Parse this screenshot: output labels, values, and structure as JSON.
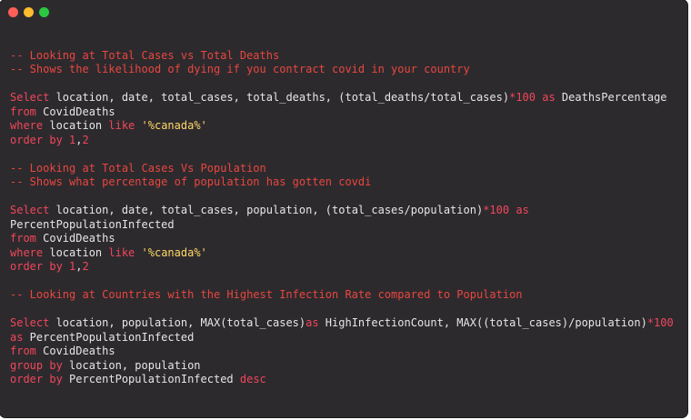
{
  "window": {
    "controls": {
      "close_color": "#ff5f57",
      "minimize_color": "#febc2e",
      "maximize_color": "#28c840"
    }
  },
  "editor": {
    "lines": [
      [],
      [
        {
          "t": "-- Looking at Total Cases vs Total Deaths",
          "c": "comment"
        }
      ],
      [
        {
          "t": "-- Shows the likelihood of dying if you contract covid in your country",
          "c": "comment"
        }
      ],
      [],
      [
        {
          "t": "Select",
          "c": "kw"
        },
        {
          "t": " location, date, total_cases, total_deaths, (total_deaths/total_cases)",
          "c": "plain"
        },
        {
          "t": "*",
          "c": "kw"
        },
        {
          "t": "100",
          "c": "num"
        },
        {
          "t": " ",
          "c": "plain"
        },
        {
          "t": "as",
          "c": "kw"
        },
        {
          "t": " DeathsPercentage",
          "c": "plain"
        }
      ],
      [
        {
          "t": "from",
          "c": "kw"
        },
        {
          "t": " CovidDeaths",
          "c": "plain"
        }
      ],
      [
        {
          "t": "where",
          "c": "kw"
        },
        {
          "t": " location ",
          "c": "plain"
        },
        {
          "t": "like",
          "c": "kw"
        },
        {
          "t": " ",
          "c": "plain"
        },
        {
          "t": "'%canada%'",
          "c": "str"
        }
      ],
      [
        {
          "t": "order by",
          "c": "kw"
        },
        {
          "t": " ",
          "c": "plain"
        },
        {
          "t": "1",
          "c": "num"
        },
        {
          "t": ",",
          "c": "plain"
        },
        {
          "t": "2",
          "c": "num"
        }
      ],
      [],
      [
        {
          "t": "-- Looking at Total Cases Vs Population",
          "c": "comment"
        }
      ],
      [
        {
          "t": "-- Shows what percentage of population has gotten covdi",
          "c": "comment"
        }
      ],
      [],
      [
        {
          "t": "Select",
          "c": "kw"
        },
        {
          "t": " location, date, total_cases, population, (total_cases/population)",
          "c": "plain"
        },
        {
          "t": "*",
          "c": "kw"
        },
        {
          "t": "100",
          "c": "num"
        },
        {
          "t": " ",
          "c": "plain"
        },
        {
          "t": "as",
          "c": "kw"
        }
      ],
      [
        {
          "t": "PercentPopulationInfected",
          "c": "plain"
        }
      ],
      [
        {
          "t": "from",
          "c": "kw"
        },
        {
          "t": " CovidDeaths",
          "c": "plain"
        }
      ],
      [
        {
          "t": "where",
          "c": "kw"
        },
        {
          "t": " location ",
          "c": "plain"
        },
        {
          "t": "like",
          "c": "kw"
        },
        {
          "t": " ",
          "c": "plain"
        },
        {
          "t": "'%canada%'",
          "c": "str"
        }
      ],
      [
        {
          "t": "order by",
          "c": "kw"
        },
        {
          "t": " ",
          "c": "plain"
        },
        {
          "t": "1",
          "c": "num"
        },
        {
          "t": ",",
          "c": "plain"
        },
        {
          "t": "2",
          "c": "num"
        }
      ],
      [],
      [
        {
          "t": "-- Looking at Countries with the Highest Infection Rate compared to Population",
          "c": "comment"
        }
      ],
      [],
      [
        {
          "t": "Select",
          "c": "kw"
        },
        {
          "t": " location, population, MAX(total_cases)",
          "c": "plain"
        },
        {
          "t": "as",
          "c": "kw"
        },
        {
          "t": " HighInfectionCount, MAX((total_cases)/population)",
          "c": "plain"
        },
        {
          "t": "*",
          "c": "kw"
        },
        {
          "t": "100",
          "c": "num"
        }
      ],
      [
        {
          "t": "as",
          "c": "kw"
        },
        {
          "t": " PercentPopulationInfected",
          "c": "plain"
        }
      ],
      [
        {
          "t": "from",
          "c": "kw"
        },
        {
          "t": " CovidDeaths",
          "c": "plain"
        }
      ],
      [
        {
          "t": "group by",
          "c": "kw"
        },
        {
          "t": " location, population",
          "c": "plain"
        }
      ],
      [
        {
          "t": "order by",
          "c": "kw"
        },
        {
          "t": " PercentPopulationInfected ",
          "c": "plain"
        },
        {
          "t": "desc",
          "c": "kw"
        }
      ]
    ]
  }
}
